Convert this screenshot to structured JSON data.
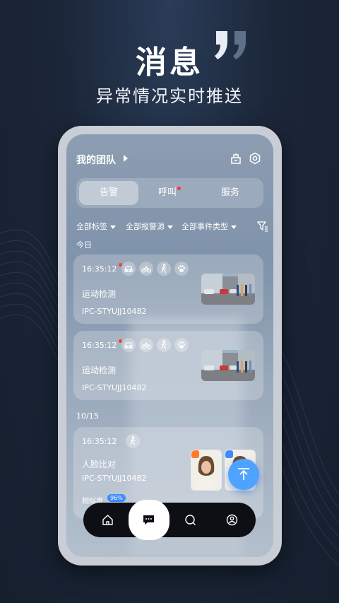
{
  "promo": {
    "title": "消息",
    "subtitle": "异常情况实时推送"
  },
  "app": {
    "team_title": "我的团队",
    "tabs": [
      {
        "label": "告警",
        "active": true,
        "badge": false
      },
      {
        "label": "呼叫",
        "active": false,
        "badge": true
      },
      {
        "label": "服务",
        "active": false,
        "badge": false
      }
    ],
    "filters": [
      "全部标签",
      "全部报警源",
      "全部事件类型"
    ],
    "sections": {
      "today": "今日",
      "earlier": "10/15"
    },
    "alerts": [
      {
        "time": "16:35:12",
        "unread": true,
        "event": "运动检测",
        "device": "IPC-STYUJJ10482",
        "type_icons": [
          "car-icon",
          "bicycle-icon",
          "pedestrian-icon",
          "pet-paw-icon"
        ]
      },
      {
        "time": "16:35:12",
        "unread": true,
        "event": "运动检测",
        "device": "IPC-STYUJJ10482",
        "type_icons": [
          "car-icon",
          "bicycle-icon",
          "pedestrian-icon",
          "pet-paw-icon"
        ]
      },
      {
        "time": "16:35:12",
        "unread": false,
        "event": "人脸比对",
        "device": "IPC-STYUJJ10482",
        "type_icons": [
          "pedestrian-icon"
        ],
        "similarity_label": "相似度",
        "similarity_value": "96%"
      }
    ],
    "nav": [
      "home-icon",
      "message-icon",
      "discover-icon",
      "profile-icon"
    ],
    "colors": {
      "accent": "#4da3ff",
      "badge_red": "#ff3b30",
      "nav_bg": "#0d0f14"
    }
  }
}
